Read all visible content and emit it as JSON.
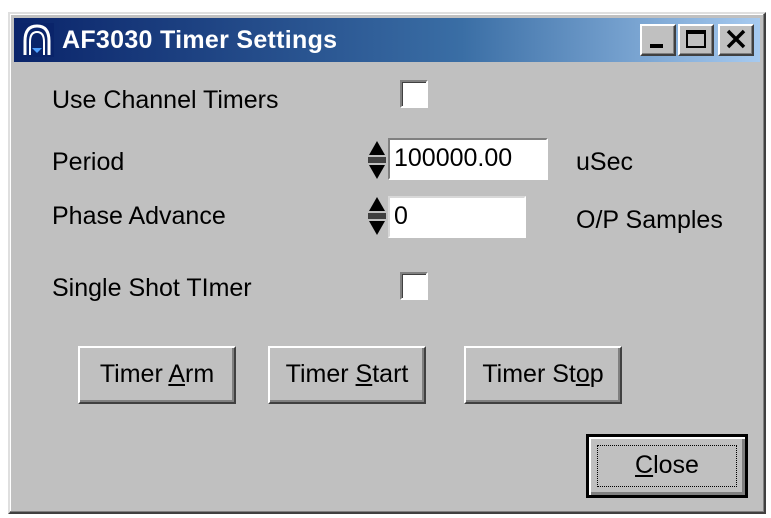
{
  "window": {
    "title": "AF3030 Timer Settings",
    "icon": "arch-icon",
    "controls": {
      "minimize_icon": "minimize-icon",
      "maximize_icon": "maximize-icon",
      "close_icon": "close-x-icon"
    }
  },
  "fields": {
    "use_channel_timers": {
      "label": "Use Channel Timers",
      "checked": false
    },
    "period": {
      "label": "Period",
      "value": "100000.00",
      "unit": "uSec"
    },
    "phase_advance": {
      "label": "Phase Advance",
      "value": "0",
      "unit": "O/P Samples"
    },
    "single_shot_timer": {
      "label": "Single Shot TImer",
      "checked": false
    }
  },
  "buttons": {
    "timer_arm": {
      "pre": "Timer ",
      "mnemonic": "A",
      "post": "rm"
    },
    "timer_start": {
      "pre": "Timer ",
      "mnemonic": "S",
      "post": "tart"
    },
    "timer_stop": {
      "pre": "Timer St",
      "mnemonic": "o",
      "post": "p"
    },
    "close": {
      "pre": "",
      "mnemonic": "C",
      "post": "lose"
    }
  },
  "colors": {
    "titlebar_start": "#0a246a",
    "titlebar_end": "#a6caf0",
    "face": "#c0c0c0"
  }
}
